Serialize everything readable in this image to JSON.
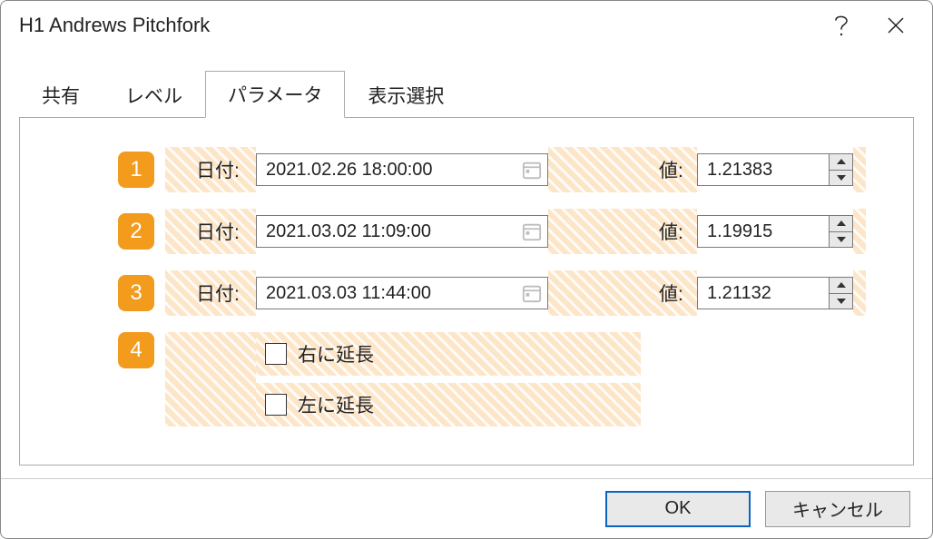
{
  "window": {
    "title": "H1 Andrews Pitchfork"
  },
  "tabs": {
    "share": "共有",
    "levels": "レベル",
    "params": "パラメータ",
    "display": "表示選択"
  },
  "labels": {
    "date": "日付:",
    "value": "値:"
  },
  "rows": [
    {
      "badge": "1",
      "date": "2021.02.26 18:00:00",
      "value": "1.21383"
    },
    {
      "badge": "2",
      "date": "2021.03.02 11:09:00",
      "value": "1.19915"
    },
    {
      "badge": "3",
      "date": "2021.03.03 11:44:00",
      "value": "1.21132"
    }
  ],
  "extend": {
    "badge": "4",
    "right": "右に延長",
    "left": "左に延長"
  },
  "footer": {
    "ok": "OK",
    "cancel": "キャンセル"
  }
}
